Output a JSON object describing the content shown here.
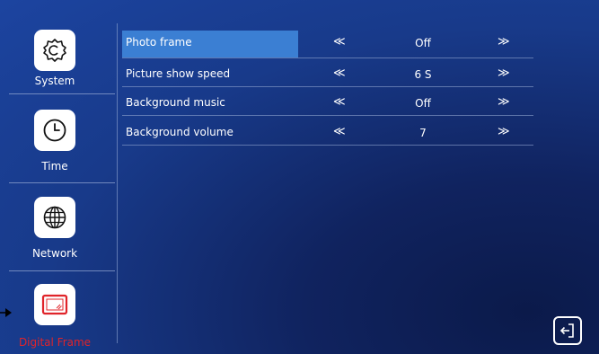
{
  "sidebar": {
    "items": [
      {
        "label": "System",
        "icon": "settings-gear-icon",
        "active": false
      },
      {
        "label": "Time",
        "icon": "clock-icon",
        "active": false
      },
      {
        "label": "Network",
        "icon": "globe-icon",
        "active": false
      },
      {
        "label": "Digital Frame",
        "icon": "photo-frame-icon",
        "active": true
      }
    ]
  },
  "settings": {
    "rows": [
      {
        "name": "Photo frame",
        "value": "Off",
        "selected": true
      },
      {
        "name": "Picture show speed",
        "value": "6 S",
        "selected": false
      },
      {
        "name": "Background music",
        "value": "Off",
        "selected": false
      },
      {
        "name": "Background volume",
        "value": "7",
        "selected": false
      }
    ],
    "prev_glyph": "≪",
    "next_glyph": "≫"
  },
  "colors": {
    "background_dark": "#0b1a4a",
    "background_light": "#1c44a0",
    "selection": "#3b7fd3",
    "active_label": "#e0242a"
  },
  "footer": {
    "exit_icon": "exit-icon"
  }
}
